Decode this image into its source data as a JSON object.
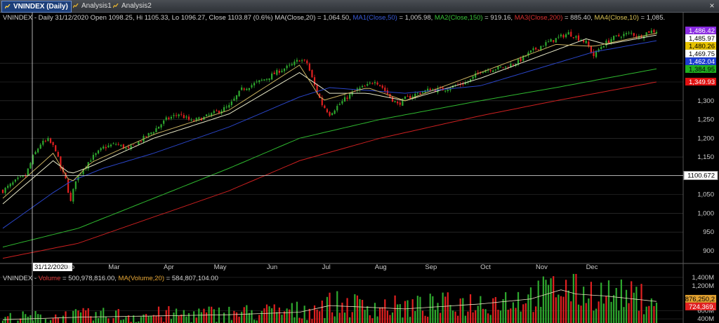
{
  "tabs": [
    {
      "label": "VNINDEX (Daily)",
      "active": true,
      "icon": "chart-icon"
    },
    {
      "label": "Analysis1",
      "active": false,
      "icon": "analysis-icon"
    },
    {
      "label": "Analysis2",
      "active": false,
      "icon": "analysis-icon"
    }
  ],
  "close_icon": "×",
  "price_header": [
    {
      "text": "VNINDEX - Daily 31/12/2020 Open 1098.25, Hi 1105.33, Lo 1096.27, Close 1103.87 (0.6%) MA(Close,20) = 1,064.50, ",
      "color": "#d0d0d0"
    },
    {
      "text": "MA1(Close,50)",
      "color": "#3a5bd8"
    },
    {
      "text": " = 1,005.98, ",
      "color": "#d0d0d0"
    },
    {
      "text": "MA2(Close,150)",
      "color": "#39c339"
    },
    {
      "text": " = 919.16, ",
      "color": "#d0d0d0"
    },
    {
      "text": "MA3(Close,200)",
      "color": "#d93030"
    },
    {
      "text": " = 885.40, ",
      "color": "#d0d0d0"
    },
    {
      "text": "MA4(Close,10)",
      "color": "#d9c255"
    },
    {
      "text": " = 1,085.",
      "color": "#d0d0d0"
    }
  ],
  "volume_header": [
    {
      "text": "VNINDEX - ",
      "color": "#d0d0d0"
    },
    {
      "text": "Volume",
      "color": "#e03a3a"
    },
    {
      "text": " = 500,978,816.00, ",
      "color": "#d0d0d0"
    },
    {
      "text": "MA(Volume,20)",
      "color": "#e0a030"
    },
    {
      "text": " = 584,807,104.00",
      "color": "#d0d0d0"
    }
  ],
  "colors": {
    "up": "#2ea82e",
    "down": "#e02020",
    "grid": "#3a3a3a",
    "ma20": "#e8e8c8",
    "ma50": "#2a45c8",
    "ma150": "#2fb82f",
    "ma200": "#cc2020",
    "ma10": "#c8b060"
  },
  "chart_data": {
    "type": "candlestick",
    "title": "VNINDEX (Daily)",
    "x_labels": [
      "31/12/2020",
      "Feb",
      "Mar",
      "Apr",
      "May",
      "Jun",
      "Jul",
      "Aug",
      "Sep",
      "Oct",
      "Nov",
      "Dec"
    ],
    "y_ticks": [
      900,
      950,
      1000,
      1050,
      1100,
      1150,
      1200,
      1250,
      1300,
      1350,
      1400
    ],
    "y_tick_labels": [
      "900",
      "950",
      "1,000",
      "1,050",
      "1,100",
      "1,150",
      "1,200",
      "1,250",
      "1,300",
      "1,350",
      "1,400"
    ],
    "ylim": [
      870,
      1505
    ],
    "crosshair_value": "1100.672",
    "right_labels": [
      {
        "text": "1,486.42",
        "value": 1486.42,
        "bg": "#8a2be2",
        "fg": "#ffffff"
      },
      {
        "text": "1,485.97",
        "value": 1485.97,
        "bg": "#ffffff",
        "fg": "#000000"
      },
      {
        "text": "1,480.26",
        "value": 1480.26,
        "bg": "#e6c200",
        "fg": "#000000"
      },
      {
        "text": "1,469.75",
        "value": 1469.75,
        "bg": "#ffffff",
        "fg": "#000000"
      },
      {
        "text": "1,462.04",
        "value": 1462.04,
        "bg": "#1e3cd0",
        "fg": "#ffffff"
      },
      {
        "text": "1,384.95",
        "value": 1384.95,
        "bg": "#20b020",
        "fg": "#000000"
      },
      {
        "text": "1,349.93",
        "value": 1349.93,
        "bg": "#e01010",
        "fg": "#ffffff"
      }
    ],
    "close_anchors": [
      [
        0,
        1060
      ],
      [
        3,
        1075
      ],
      [
        6,
        1090
      ],
      [
        9,
        1100
      ],
      [
        12,
        1150
      ],
      [
        15,
        1185
      ],
      [
        18,
        1195
      ],
      [
        21,
        1170
      ],
      [
        23,
        1120
      ],
      [
        25,
        1090
      ],
      [
        27,
        1030
      ],
      [
        29,
        1090
      ],
      [
        31,
        1110
      ],
      [
        35,
        1145
      ],
      [
        40,
        1175
      ],
      [
        45,
        1185
      ],
      [
        50,
        1170
      ],
      [
        55,
        1195
      ],
      [
        60,
        1220
      ],
      [
        65,
        1250
      ],
      [
        70,
        1265
      ],
      [
        75,
        1245
      ],
      [
        80,
        1255
      ],
      [
        85,
        1270
      ],
      [
        90,
        1285
      ],
      [
        95,
        1330
      ],
      [
        100,
        1345
      ],
      [
        105,
        1360
      ],
      [
        110,
        1380
      ],
      [
        115,
        1395
      ],
      [
        118,
        1410
      ],
      [
        121,
        1400
      ],
      [
        124,
        1340
      ],
      [
        127,
        1290
      ],
      [
        130,
        1265
      ],
      [
        133,
        1285
      ],
      [
        137,
        1310
      ],
      [
        141,
        1330
      ],
      [
        145,
        1340
      ],
      [
        148,
        1355
      ],
      [
        151,
        1335
      ],
      [
        154,
        1310
      ],
      [
        157,
        1290
      ],
      [
        160,
        1305
      ],
      [
        165,
        1320
      ],
      [
        170,
        1330
      ],
      [
        175,
        1330
      ],
      [
        180,
        1340
      ],
      [
        185,
        1350
      ],
      [
        190,
        1380
      ],
      [
        195,
        1385
      ],
      [
        200,
        1390
      ],
      [
        205,
        1405
      ],
      [
        210,
        1430
      ],
      [
        215,
        1450
      ],
      [
        220,
        1465
      ],
      [
        225,
        1480
      ],
      [
        228,
        1470
      ],
      [
        232,
        1455
      ],
      [
        235,
        1420
      ],
      [
        238,
        1445
      ],
      [
        242,
        1465
      ],
      [
        246,
        1475
      ],
      [
        250,
        1480
      ],
      [
        253,
        1470
      ],
      [
        257,
        1485
      ],
      [
        260,
        1486
      ]
    ],
    "ma_anchors": {
      "ma20": [
        [
          0,
          1025
        ],
        [
          20,
          1140
        ],
        [
          27,
          1105
        ],
        [
          35,
          1125
        ],
        [
          60,
          1200
        ],
        [
          90,
          1265
        ],
        [
          118,
          1375
        ],
        [
          130,
          1320
        ],
        [
          145,
          1320
        ],
        [
          160,
          1300
        ],
        [
          190,
          1360
        ],
        [
          220,
          1435
        ],
        [
          232,
          1465
        ],
        [
          240,
          1450
        ],
        [
          260,
          1475
        ]
      ],
      "ma50": [
        [
          0,
          960
        ],
        [
          20,
          1055
        ],
        [
          27,
          1085
        ],
        [
          40,
          1120
        ],
        [
          60,
          1160
        ],
        [
          90,
          1230
        ],
        [
          118,
          1310
        ],
        [
          130,
          1335
        ],
        [
          160,
          1320
        ],
        [
          190,
          1340
        ],
        [
          220,
          1400
        ],
        [
          235,
          1430
        ],
        [
          260,
          1460
        ]
      ],
      "ma150": [
        [
          0,
          910
        ],
        [
          30,
          960
        ],
        [
          60,
          1040
        ],
        [
          90,
          1120
        ],
        [
          118,
          1200
        ],
        [
          150,
          1250
        ],
        [
          190,
          1300
        ],
        [
          220,
          1335
        ],
        [
          260,
          1385
        ]
      ],
      "ma200": [
        [
          0,
          880
        ],
        [
          30,
          920
        ],
        [
          60,
          990
        ],
        [
          90,
          1060
        ],
        [
          118,
          1140
        ],
        [
          150,
          1200
        ],
        [
          190,
          1260
        ],
        [
          220,
          1300
        ],
        [
          260,
          1350
        ]
      ],
      "ma10": [
        [
          0,
          1040
        ],
        [
          20,
          1160
        ],
        [
          27,
          1080
        ],
        [
          35,
          1135
        ],
        [
          60,
          1210
        ],
        [
          90,
          1275
        ],
        [
          118,
          1395
        ],
        [
          127,
          1300
        ],
        [
          145,
          1335
        ],
        [
          160,
          1300
        ],
        [
          190,
          1375
        ],
        [
          220,
          1450
        ],
        [
          235,
          1445
        ],
        [
          260,
          1480
        ]
      ]
    },
    "volume": {
      "y_ticks": [
        400,
        600,
        1200,
        1400
      ],
      "y_tick_labels": [
        "400M",
        "600M",
        "1,200M",
        "1,400M"
      ],
      "ylim": [
        300,
        1500
      ],
      "right_labels": [
        {
          "text": "876,250,2",
          "value": 876,
          "bg": "#e0a030",
          "fg": "#000000"
        },
        {
          "text": "724,369,",
          "value": 724,
          "bg": "#e02020",
          "fg": "#ffffff"
        }
      ],
      "anchors": [
        [
          0,
          380
        ],
        [
          30,
          440
        ],
        [
          60,
          470
        ],
        [
          90,
          500
        ],
        [
          118,
          560
        ],
        [
          130,
          720
        ],
        [
          160,
          640
        ],
        [
          190,
          760
        ],
        [
          210,
          880
        ],
        [
          222,
          1100
        ],
        [
          228,
          1000
        ],
        [
          240,
          950
        ],
        [
          260,
          820
        ]
      ]
    }
  }
}
